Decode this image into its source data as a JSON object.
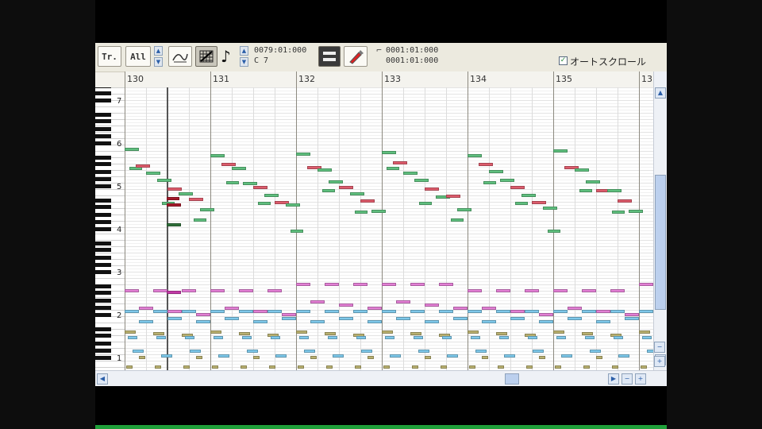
{
  "toolbar": {
    "track_button": "Tr.",
    "track_select": "All",
    "position_top": "0079:01:000",
    "pitch_readout": "C 7",
    "range_start": "0001:01:000",
    "range_end": "0001:01:000",
    "autoscroll_label": "オートスクロール",
    "autoscroll_checked": true
  },
  "ruler": {
    "bars": [
      "130",
      "131",
      "132",
      "133",
      "134",
      "135",
      "13"
    ]
  },
  "keyboard": {
    "octaves": [
      "7",
      "6",
      "5",
      "4",
      "3",
      "2",
      "1"
    ]
  },
  "colors": {
    "pink": "#e27fd4",
    "light_blue": "#7ec8ea",
    "green": "#5fbf7e",
    "red": "#dd5c6c",
    "olive": "#b9b070",
    "dark_pink": "#c43aa8",
    "dark_red": "#a41a2a"
  },
  "notes": {
    "green_high": [
      [
        0,
        2
      ],
      [
        2,
        2
      ],
      [
        4,
        2
      ],
      [
        6,
        2
      ],
      [
        8,
        2
      ],
      [
        10,
        2
      ],
      [
        12,
        2
      ],
      [
        14,
        2
      ],
      [
        16,
        2
      ],
      [
        18,
        2
      ],
      [
        20,
        2
      ],
      [
        22,
        2
      ],
      [
        24,
        2
      ],
      [
        26,
        2
      ],
      [
        28,
        2
      ],
      [
        30,
        2
      ],
      [
        32,
        2
      ],
      [
        34,
        2
      ],
      [
        36,
        2
      ]
    ]
  }
}
